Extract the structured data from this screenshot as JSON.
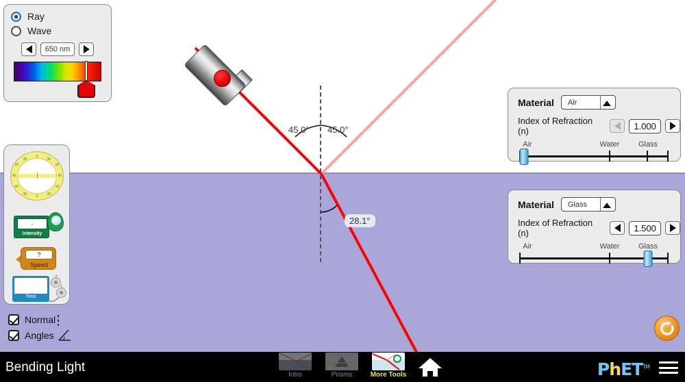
{
  "sim": {
    "title": "Bending Light",
    "brand": "PhET",
    "brand_h": "h",
    "brand_tm": "TM"
  },
  "colors": {
    "ray_incident": "#ff0000",
    "ray_reflected": "#f9a3a3",
    "ray_refracted": "#ff0000",
    "medium_top": "#ffffff",
    "medium_bottom": "#aba6d8",
    "accent_orange": "#f2921f",
    "active_tab": "#f2e835",
    "slider_thumb": "#64b8e0"
  },
  "ray_wave_panel": {
    "options": [
      {
        "label": "Ray",
        "selected": true
      },
      {
        "label": "Wave",
        "selected": false
      }
    ],
    "wavelength": {
      "value": "650 nm",
      "decrement_label": "◀",
      "increment_label": "▶",
      "thumb_percent": 82
    }
  },
  "toolbox": {
    "protractor": {
      "name": "protractor",
      "ticks": [
        "0",
        "30",
        "60",
        "90",
        "60",
        "30",
        "0",
        "30",
        "60",
        "90",
        "60",
        "30"
      ]
    },
    "intensity_meter": {
      "label": "Intensity",
      "reading": "-"
    },
    "speed_meter": {
      "label": "Speed",
      "reading": "?"
    },
    "time_meter": {
      "label": "Time"
    }
  },
  "checkboxes": [
    {
      "label": "Normal",
      "checked": true,
      "icon": "dashed-line-icon"
    },
    {
      "label": "Angles",
      "checked": true,
      "icon": "angle-icon"
    }
  ],
  "materials": [
    {
      "panel": "top",
      "material_label": "Material",
      "material_value": "Air",
      "ior_label": "Index of Refraction (n)",
      "ior_value": "1.000",
      "decrement_enabled": false,
      "increment_enabled": true,
      "slider": {
        "ticks": [
          {
            "label": "Air",
            "percent": 0
          },
          {
            "label": "Water",
            "percent": 60
          },
          {
            "label": "Glass",
            "percent": 85
          }
        ],
        "thumb_percent": 2
      }
    },
    {
      "panel": "bottom",
      "material_label": "Material",
      "material_value": "Glass",
      "ior_label": "Index of Refraction (n)",
      "ior_value": "1.500",
      "decrement_enabled": true,
      "increment_enabled": true,
      "slider": {
        "ticks": [
          {
            "label": "Air",
            "percent": 0
          },
          {
            "label": "Water",
            "percent": 60
          },
          {
            "label": "Glass",
            "percent": 85
          }
        ],
        "thumb_percent": 85
      }
    }
  ],
  "angles": {
    "incident": "45.0°",
    "reflected": "45.0°",
    "refracted": "28.1°"
  },
  "navbar": {
    "tabs": [
      {
        "label": "Intro",
        "active": false
      },
      {
        "label": "Prisms",
        "active": false
      },
      {
        "label": "More Tools",
        "active": true
      }
    ],
    "home_icon": "home-icon",
    "menu_icon": "hamburger-menu-icon"
  },
  "reset": {
    "icon": "reset-all-icon"
  }
}
